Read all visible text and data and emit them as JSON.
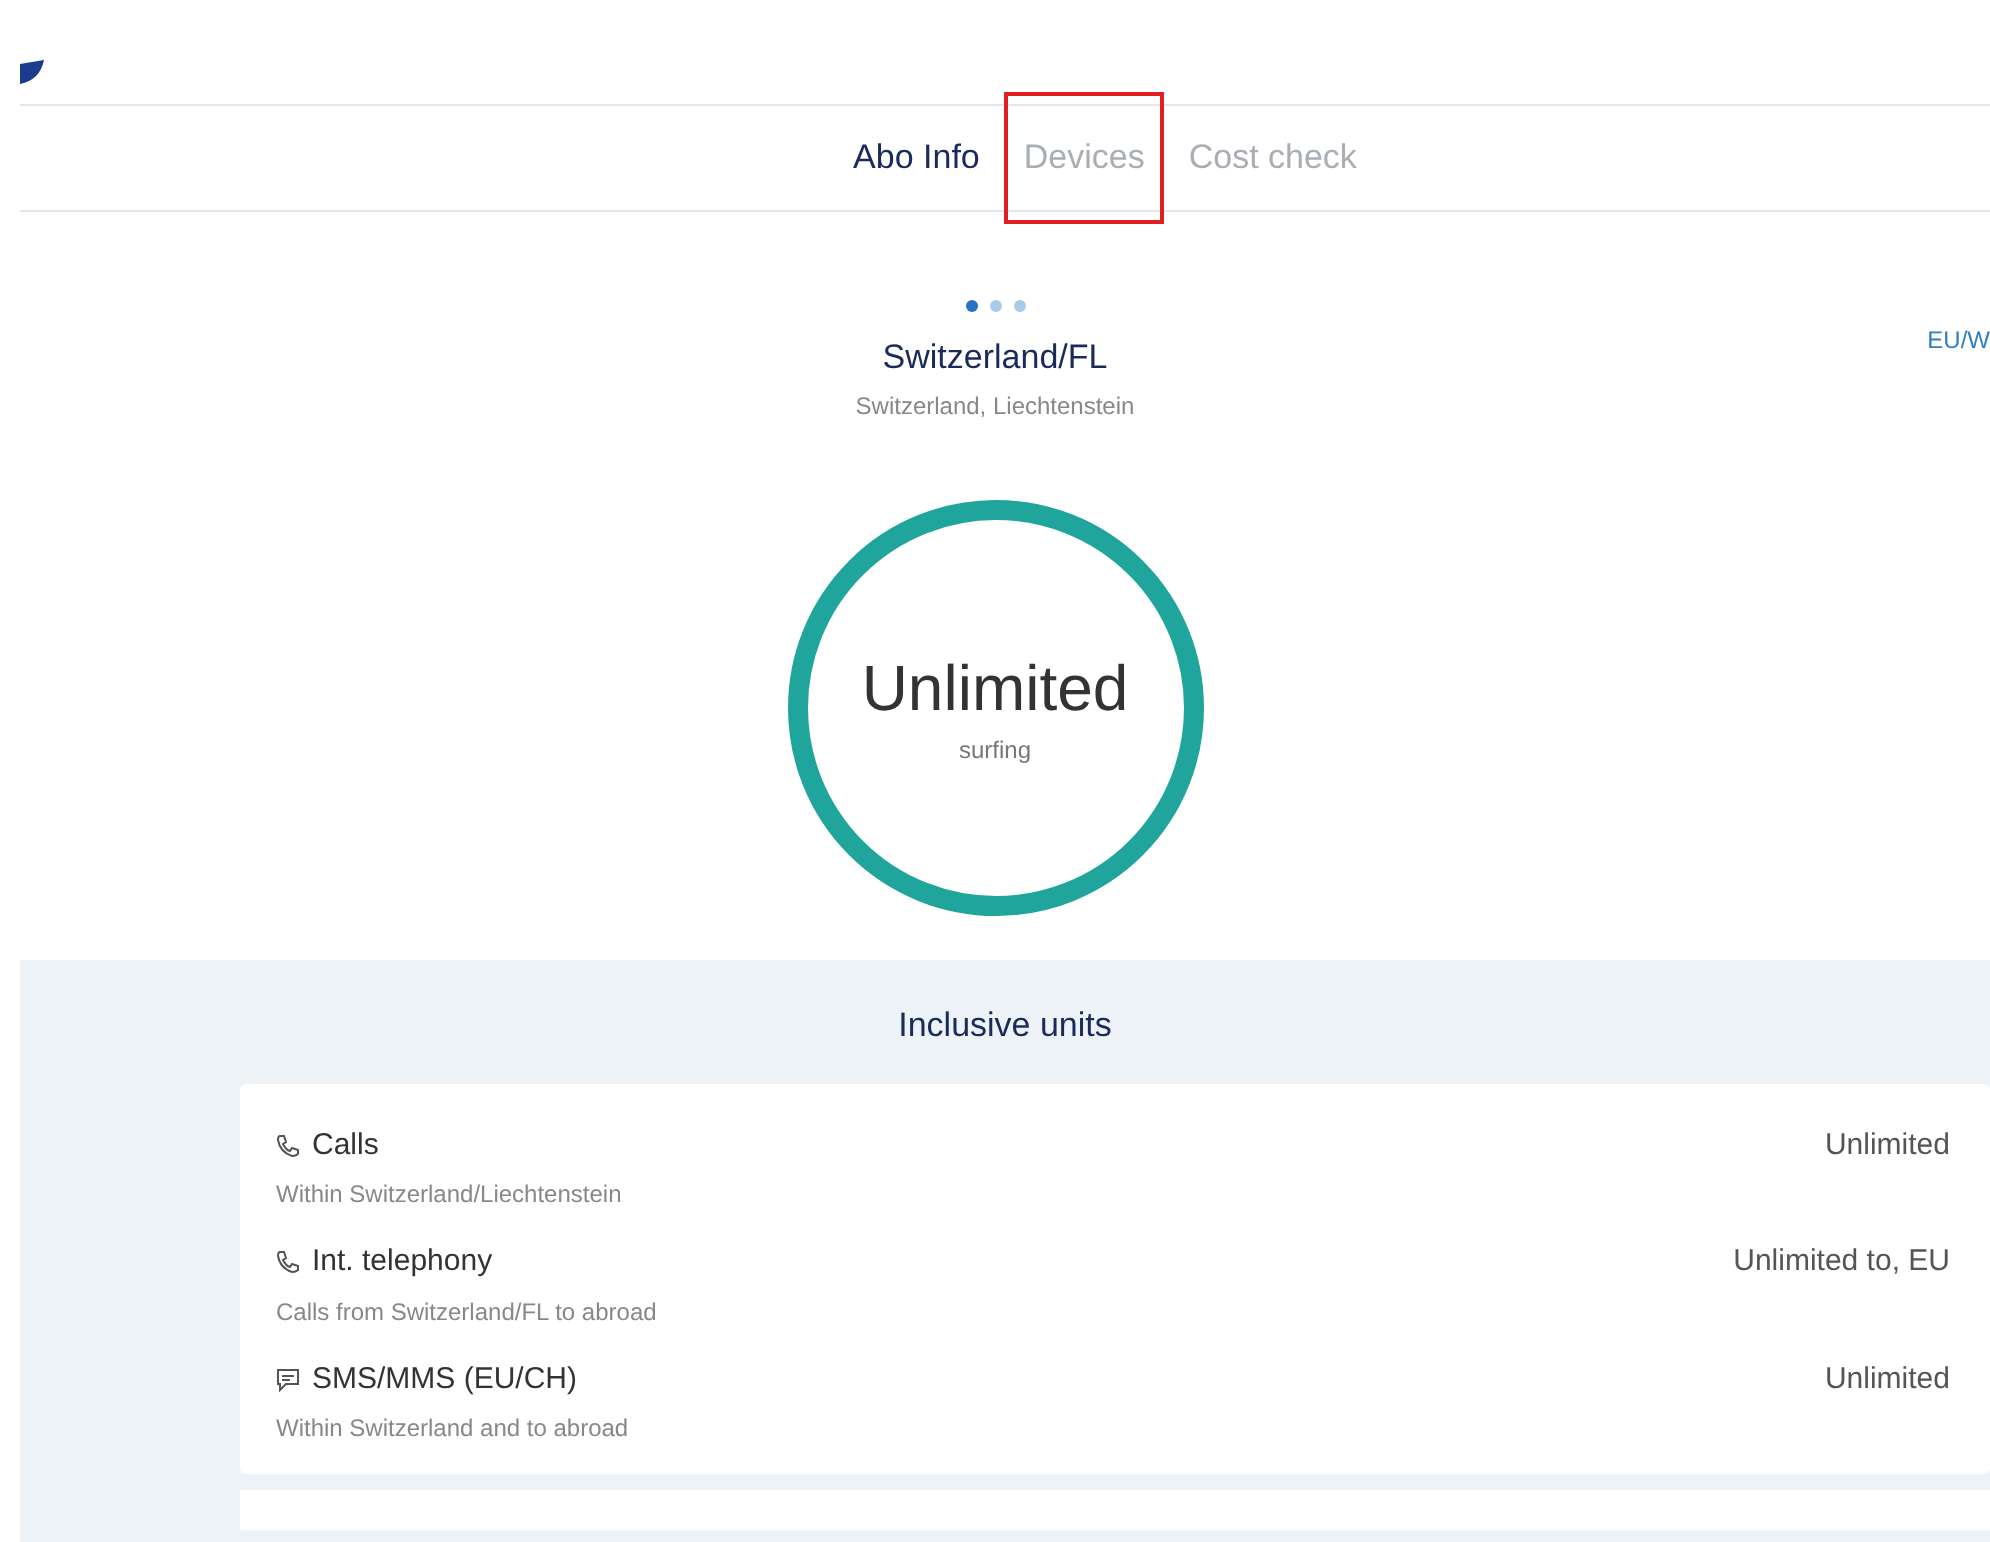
{
  "tabs": [
    {
      "label": "Abo Info",
      "selected": true,
      "highlighted": false
    },
    {
      "label": "Devices",
      "selected": false,
      "highlighted": true
    },
    {
      "label": "Cost check",
      "selected": false,
      "highlighted": false
    }
  ],
  "carousel": {
    "dots": [
      {
        "selected": true
      },
      {
        "selected": false
      },
      {
        "selected": false
      }
    ],
    "title": "Switzerland/FL",
    "subtitle": "Switzerland, Liechtenstein",
    "next_title": "EU/W",
    "gauge_value": "Unlimited",
    "gauge_label": "surfing"
  },
  "inclusive_units": {
    "title": "Inclusive units",
    "rows": [
      {
        "kind": "call",
        "name": "Calls",
        "detail": "Within Switzerland/Liechtenstein",
        "value": "Unlimited"
      },
      {
        "kind": "call",
        "name": "Int. telephony",
        "detail": "Calls from Switzerland/FL to abroad",
        "value": "Unlimited to, EU"
      },
      {
        "kind": "sms",
        "name": "SMS/MMS (EU/CH)",
        "detail": "Within Switzerland and to abroad",
        "value": "Unlimited"
      }
    ]
  }
}
